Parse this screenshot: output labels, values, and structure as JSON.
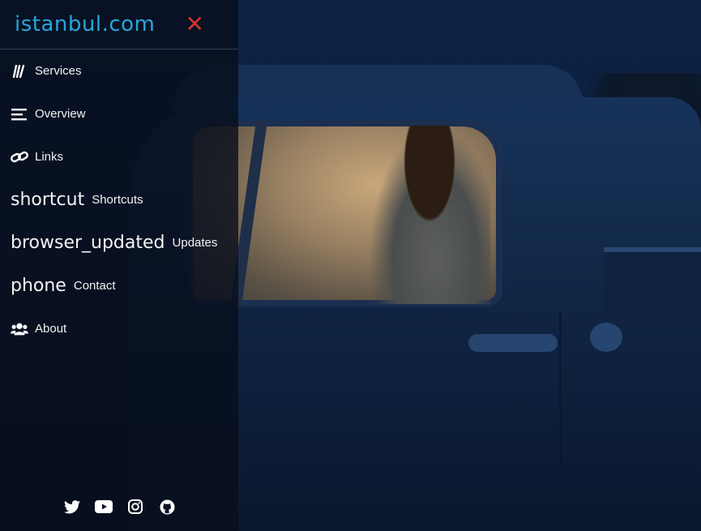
{
  "sidebar": {
    "brand": "istanbul.com",
    "close_glyph": "✕",
    "items": [
      {
        "icon": "books-icon",
        "ligature": "",
        "label": "Services"
      },
      {
        "icon": "bars-icon",
        "ligature": "",
        "label": "Overview"
      },
      {
        "icon": "link-icon",
        "ligature": "",
        "label": "Links"
      },
      {
        "icon": "",
        "ligature": "shortcut",
        "label": "Shortcuts"
      },
      {
        "icon": "",
        "ligature": "browser_updated",
        "label": "Updates"
      },
      {
        "icon": "",
        "ligature": "phone",
        "label": "Contact"
      },
      {
        "icon": "users-icon",
        "ligature": "",
        "label": "About"
      }
    ],
    "social": [
      "twitter-icon",
      "youtube-icon",
      "instagram-icon",
      "github-icon"
    ]
  },
  "colors": {
    "brand": "#2aa6d9",
    "close": "#d2322b",
    "sidebar_bg": "rgba(8,14,28,0.80)"
  }
}
